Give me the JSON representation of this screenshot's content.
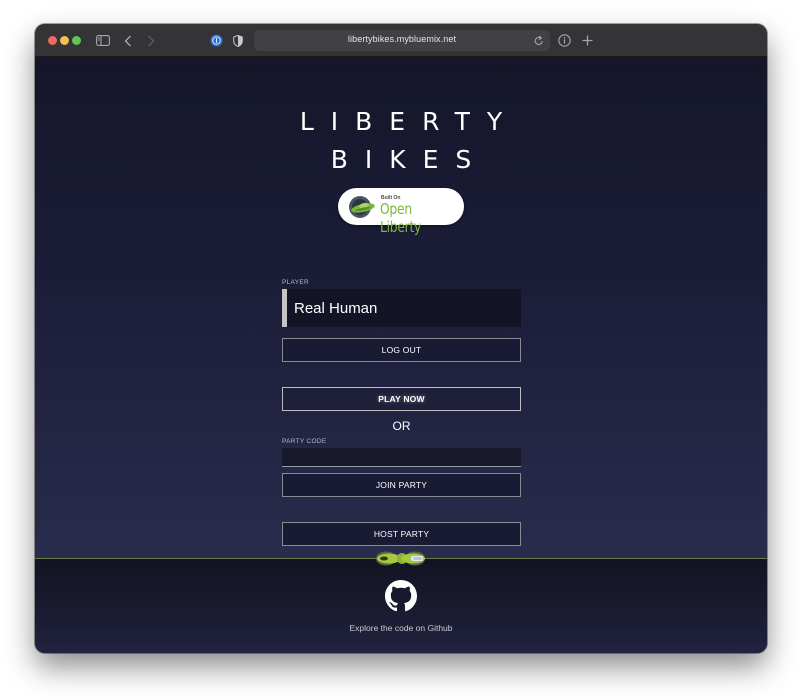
{
  "browser": {
    "url": "libertybikes.mybluemix.net",
    "icons": [
      "sidebar-icon",
      "back-icon",
      "forward-icon",
      "password-manager-icon",
      "privacy-shield-icon",
      "reload-icon",
      "info-icon",
      "new-tab-icon"
    ]
  },
  "header": {
    "title_line1": "LIBERTY",
    "title_line2": "BIKES",
    "badge_small": "Built On",
    "badge_name": "Open Liberty"
  },
  "form": {
    "player_label": "PLAYER",
    "player_name": "Real Human",
    "logout_label": "LOG OUT",
    "play_now_label": "PLAY NOW",
    "or_text": "OR",
    "party_code_label": "PARTY CODE",
    "party_code_value": "",
    "join_party_label": "JOIN PARTY",
    "host_party_label": "HOST PARTY"
  },
  "footer": {
    "github_text": "Explore the code on Github"
  },
  "colors": {
    "accent_green": "#7ab83d",
    "page_bg_top": "#15162a",
    "page_bg_bottom": "#2a2c4d"
  }
}
